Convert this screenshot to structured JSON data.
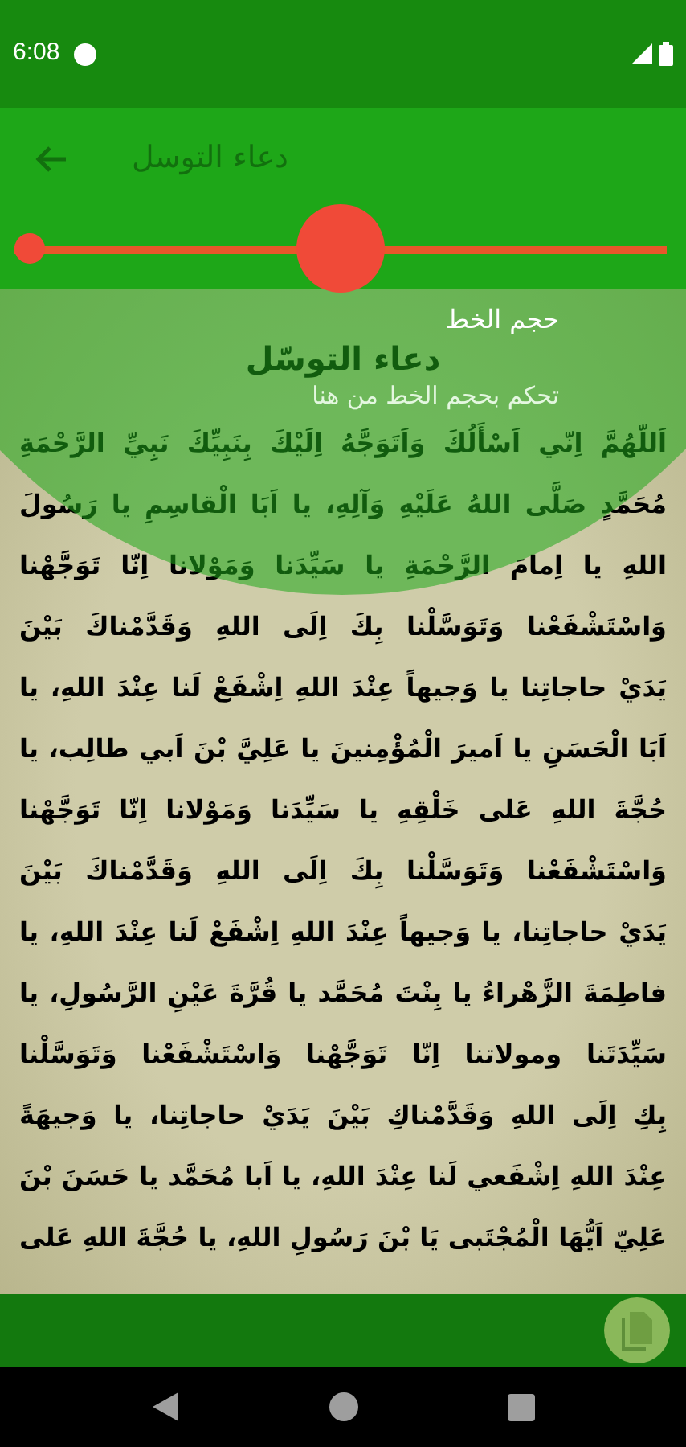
{
  "status_bar": {
    "time": "6:08"
  },
  "app_bar": {
    "title": "دعاء التوسل"
  },
  "font_size_slider": {
    "level": 0.5
  },
  "prayer": {
    "title": "دعاء التوسّل",
    "lines": [
      "اَللّهُمَّ اِنّي اَسْأَلُكَ وَاَتَوَجَّهُ اِلَيْكَ بِنَبِيِّكَ نَبِيِّ الرَّحْمَةِ",
      "مُحَمَّدٍ صَلَّى اللهُ عَلَيْهِ وَآلِهِ، يا اَبَا الْقاسِمِ يا رَسُولَ",
      "اللهِ يا اِمامَ الرَّحْمَةِ يا سَيِّدَنا وَمَوْلانا اِنّا تَوَجَّهْنا",
      "وَاسْتَشْفَعْنا وَتَوَسَّلْنا بِكَ اِلَى اللهِ وَقَدَّمْناكَ بَيْنَ",
      "يَدَيْ حاجاتِنا يا وَجيهاً عِنْدَ اللهِ اِشْفَعْ لَنا عِنْدَ اللهِ، يا",
      "اَبَا الْحَسَنِ يا اَميرَ الْمُؤْمِنينَ يا عَلِيَّ بْنَ اَبي طالِب، يا",
      "حُجَّةَ اللهِ عَلى خَلْقِهِ يا سَيِّدَنا وَمَوْلانا اِنّا تَوَجَّهْنا",
      "وَاسْتَشْفَعْنا وَتَوَسَّلْنا بِكَ اِلَى اللهِ وَقَدَّمْناكَ بَيْنَ",
      "يَدَيْ حاجاتِنا، يا وَجيهاً عِنْدَ اللهِ اِشْفَعْ لَنا عِنْدَ اللهِ، يا",
      "فاطِمَةَ الزَّهْراءُ يا بِنْتَ مُحَمَّد يا قُرَّةَ عَيْنِ الرَّسُولِ، يا",
      "سَيِّدَتَنا ومولاتنا اِنّا تَوَجَّهْنا وَاسْتَشْفَعْنا وَتَوَسَّلْنا",
      "بِكِ اِلَى اللهِ وَقَدَّمْناكِ بَيْنَ يَدَيْ حاجاتِنا، يا وَجيهَةً",
      "عِنْدَ اللهِ اِشْفَعي لَنا عِنْدَ اللهِ، يا اَبا مُحَمَّد يا حَسَنَ بْنَ",
      "عَلِيّ اَيُّهَا الْمُجْتَبى يَا بْنَ رَسُولِ اللهِ، يا حُجَّةَ اللهِ عَلى"
    ]
  },
  "tutorial": {
    "title": "حجم الخط",
    "description": "تحكم بحجم الخط من هنا"
  }
}
